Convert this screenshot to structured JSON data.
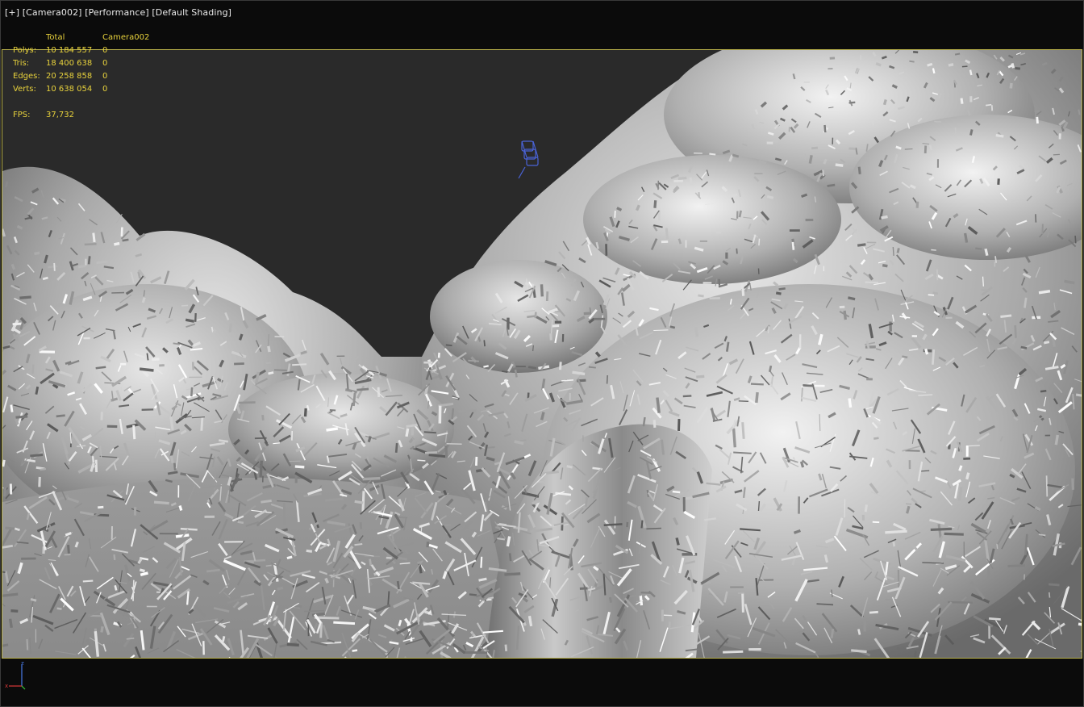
{
  "viewport": {
    "label_parts": [
      "[+]",
      "[Camera002]",
      "[Performance]",
      "[Default Shading]"
    ]
  },
  "stats": {
    "header_total": "Total",
    "header_camera": "Camera002",
    "rows": [
      {
        "label": "Polys:",
        "total": "10 184 557",
        "camera": "0"
      },
      {
        "label": "Tris:",
        "total": "18 400 638",
        "camera": "0"
      },
      {
        "label": "Edges:",
        "total": "20 258 858",
        "camera": "0"
      },
      {
        "label": "Verts:",
        "total": "10 638 054",
        "camera": "0"
      }
    ],
    "fps_label": "FPS:",
    "fps_value": "37,732"
  },
  "axis": {
    "x": "x",
    "z": "z"
  },
  "colors": {
    "stats_text": "#e8d23c",
    "frame_border": "#b8b04a",
    "background": "#0b0b0b",
    "sky": "#2a2a2a",
    "camera_gizmo": "#4a63d8"
  }
}
